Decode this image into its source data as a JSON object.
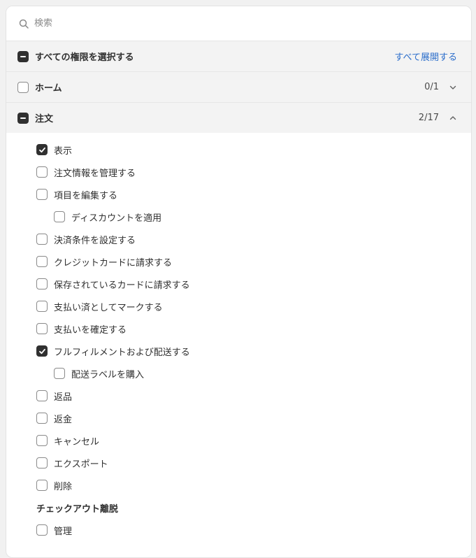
{
  "search": {
    "placeholder": "検索"
  },
  "select_all": {
    "label": "すべての権限を選択する",
    "expand_label": "すべて展開する"
  },
  "groups": [
    {
      "label": "ホーム",
      "count": "0/1"
    },
    {
      "label": "注文",
      "count": "2/17"
    }
  ],
  "order_items": [
    {
      "label": "表示",
      "checked": true
    },
    {
      "label": "注文情報を管理する",
      "checked": false
    },
    {
      "label": "項目を編集する",
      "checked": false
    },
    {
      "label": "ディスカウントを適用",
      "checked": false
    },
    {
      "label": "決済条件を設定する",
      "checked": false
    },
    {
      "label": "クレジットカードに請求する",
      "checked": false
    },
    {
      "label": "保存されているカードに請求する",
      "checked": false
    },
    {
      "label": "支払い済としてマークする",
      "checked": false
    },
    {
      "label": "支払いを確定する",
      "checked": false
    },
    {
      "label": "フルフィルメントおよび配送する",
      "checked": true
    },
    {
      "label": "配送ラベルを購入",
      "checked": false
    },
    {
      "label": "返品",
      "checked": false
    },
    {
      "label": "返金",
      "checked": false
    },
    {
      "label": "キャンセル",
      "checked": false
    },
    {
      "label": "エクスポート",
      "checked": false
    },
    {
      "label": "削除",
      "checked": false
    }
  ],
  "checkout_abandon": {
    "title": "チェックアウト離脱",
    "items": [
      {
        "label": "管理",
        "checked": false
      }
    ]
  },
  "colors": {
    "link": "#2c6ecb",
    "checkbox_fill": "#303030",
    "group_bg": "#f3f3f3"
  }
}
